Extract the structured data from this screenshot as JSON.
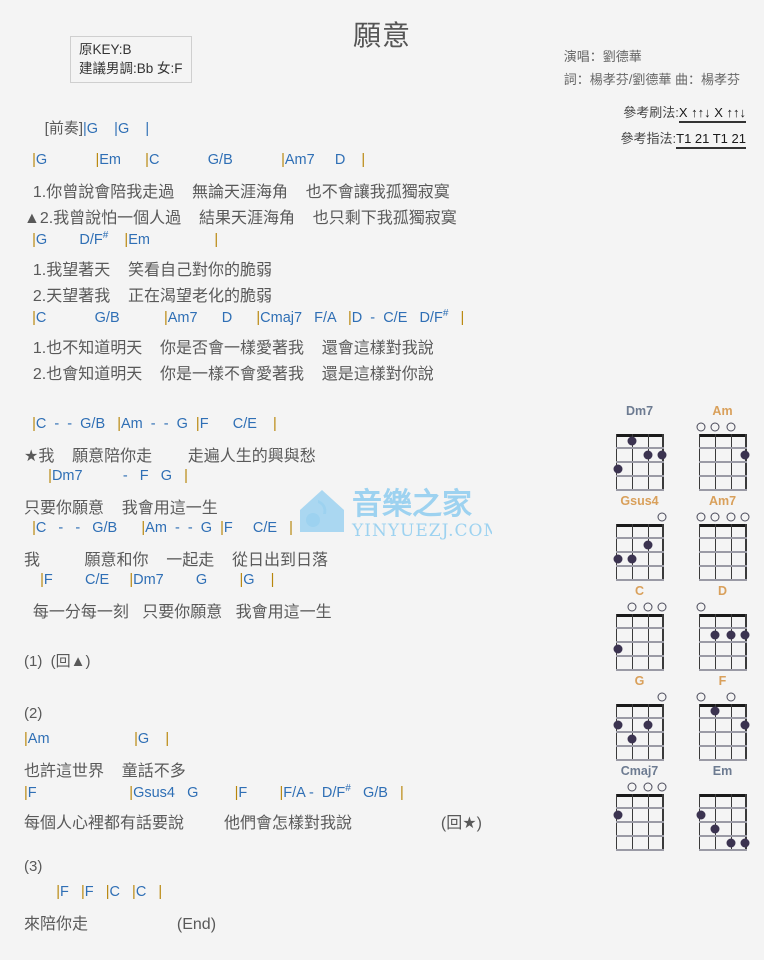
{
  "header": {
    "title": "願意",
    "key_original": "原KEY:B",
    "key_suggested": "建議男調:Bb 女:F",
    "singer": "演唱：劉德華",
    "writers": "詞：楊孝芬/劉德華  曲：楊孝芬",
    "strum_label": "參考刷法:",
    "strum_pattern": "X ↑↑↓ X ↑↑↓",
    "finger_label": "參考指法:",
    "finger_pattern": "T1 21 T1 21"
  },
  "intro": {
    "label": "[前奏]",
    "chords": "|G    |G    |"
  },
  "sections": [
    {
      "name": "verse-1",
      "lines": [
        {
          "type": "chords",
          "text": "  |G            |Em      |C            G/B            |Am7     D    |"
        },
        {
          "type": "lyric",
          "text": "  1.你曾說會陪我走過    無論天涯海角    也不會讓我孤獨寂寞"
        },
        {
          "type": "lyric",
          "text": "▲2.我曾說怕一個人過    結果天涯海角    也只剩下我孤獨寂寞"
        },
        {
          "type": "chords",
          "text": "  |G        D/F#    |Em                |"
        },
        {
          "type": "lyric",
          "text": "  1.我望著天    笑看自己對你的脆弱"
        },
        {
          "type": "lyric",
          "text": "  2.天望著我    正在渴望老化的脆弱"
        },
        {
          "type": "chords",
          "text": "  |C            G/B           |Am7      D      |Cmaj7   F/A   |D  -  C/E   D/F#   |"
        },
        {
          "type": "lyric",
          "text": "  1.也不知道明天    你是否會一樣愛著我    還會這樣對我說"
        },
        {
          "type": "lyric",
          "text": "  2.也會知道明天    你是一樣不會愛著我    還是這樣對你說"
        }
      ]
    },
    {
      "name": "chorus",
      "lines": [
        {
          "type": "chords",
          "text": "  |C  -  -  G/B   |Am  -  -  G  |F      C/E    |"
        },
        {
          "type": "lyric",
          "text": "★我    願意陪你走        走遍人生的興與愁"
        },
        {
          "type": "chords",
          "text": "      |Dm7          -   F   G   |"
        },
        {
          "type": "lyric",
          "text": "只要你願意    我會用這一生"
        },
        {
          "type": "chords",
          "text": "  |C   -   -   G/B      |Am  -  -  G  |F     C/E   |"
        },
        {
          "type": "lyric",
          "text": "我          願意和你    一起走    從日出到日落"
        },
        {
          "type": "chords",
          "text": "    |F        C/E     |Dm7        G        |G    |"
        },
        {
          "type": "lyric",
          "text": "  每一分每一刻   只要你願意   我會用這一生"
        }
      ]
    },
    {
      "name": "interlude-1",
      "lines": [
        {
          "type": "plain",
          "text": "(1)  (回▲)"
        }
      ]
    },
    {
      "name": "verse-2",
      "lines": [
        {
          "type": "plain",
          "text": "(2)"
        },
        {
          "type": "chords",
          "text": "|Am                     |G    |"
        },
        {
          "type": "lyric",
          "text": "也許這世界    童話不多"
        },
        {
          "type": "chords",
          "text": "|F                       |Gsus4   G         |F        |F/A -  D/F#   G/B   |"
        },
        {
          "type": "lyric",
          "text": "每個人心裡都有話要說         他們會怎樣對我說                    (回★)"
        }
      ]
    },
    {
      "name": "outro",
      "lines": [
        {
          "type": "plain",
          "text": "(3)"
        },
        {
          "type": "chords",
          "text": "        |F   |F   |C   |C   |"
        },
        {
          "type": "lyric",
          "text": "來陪你走                    (End)"
        }
      ]
    }
  ],
  "chord_diagrams": [
    {
      "name": "Dm7",
      "label_color": "gray",
      "open": [],
      "dots": [
        {
          "s": 4,
          "f": 2
        },
        {
          "s": 3,
          "f": 2
        },
        {
          "s": 2,
          "f": 1
        },
        {
          "s": 1,
          "f": 3
        }
      ]
    },
    {
      "name": "Am",
      "label_color": "orange",
      "open": [
        3,
        2,
        1
      ],
      "dots": [
        {
          "s": 4,
          "f": 2
        }
      ]
    },
    {
      "name": "Gsus4",
      "label_color": "orange",
      "open": [
        4
      ],
      "dots": [
        {
          "s": 3,
          "f": 2
        },
        {
          "s": 2,
          "f": 3
        },
        {
          "s": 1,
          "f": 3
        }
      ]
    },
    {
      "name": "Am7",
      "label_color": "orange",
      "open": [
        4,
        3,
        2,
        1
      ],
      "dots": []
    },
    {
      "name": "C",
      "label_color": "orange",
      "open": [
        4,
        3,
        2
      ],
      "dots": [
        {
          "s": 1,
          "f": 3
        }
      ]
    },
    {
      "name": "D",
      "label_color": "orange",
      "open": [
        1
      ],
      "dots": [
        {
          "s": 4,
          "f": 2
        },
        {
          "s": 3,
          "f": 2
        },
        {
          "s": 2,
          "f": 2
        }
      ]
    },
    {
      "name": "G",
      "label_color": "orange",
      "open": [
        4
      ],
      "dots": [
        {
          "s": 3,
          "f": 2
        },
        {
          "s": 2,
          "f": 3
        },
        {
          "s": 1,
          "f": 2
        }
      ]
    },
    {
      "name": "F",
      "label_color": "orange",
      "open": [
        3,
        1
      ],
      "dots": [
        {
          "s": 4,
          "f": 2
        },
        {
          "s": 2,
          "f": 1
        }
      ]
    },
    {
      "name": "Cmaj7",
      "label_color": "gray",
      "open": [
        4,
        3,
        2
      ],
      "dots": [
        {
          "s": 1,
          "f": 2
        }
      ]
    },
    {
      "name": "Em",
      "label_color": "gray",
      "open": [],
      "dots": [
        {
          "s": 4,
          "f": 4
        },
        {
          "s": 3,
          "f": 4
        },
        {
          "s": 2,
          "f": 3
        },
        {
          "s": 1,
          "f": 2
        }
      ]
    }
  ],
  "watermark": {
    "text_cn": "音樂之家",
    "text_en": "YINYUEZJ.COM",
    "color": "#8ecdf0"
  }
}
